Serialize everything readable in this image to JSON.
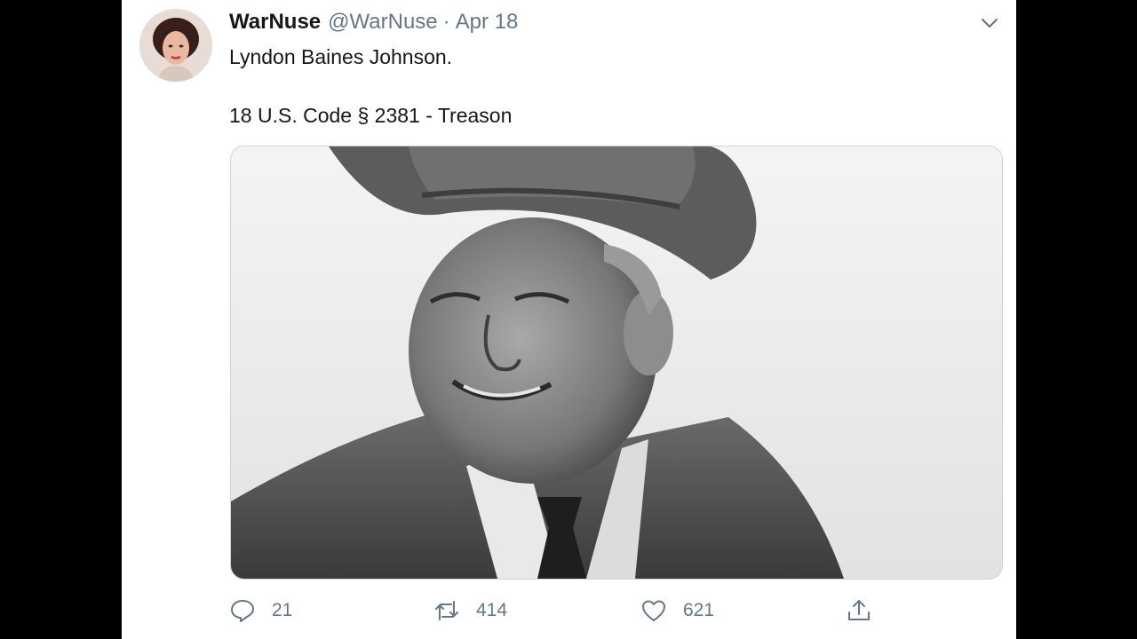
{
  "tweet": {
    "display_name": "WarNuse",
    "handle": "@WarNuse",
    "separator": "·",
    "date": "Apr 18",
    "text_line1": "Lyndon Baines Johnson.",
    "text_line2": "18 U.S. Code § 2381 - Treason"
  },
  "actions": {
    "reply_count": "21",
    "retweet_count": "414",
    "like_count": "621"
  },
  "icons": {
    "avatar": "profile-avatar",
    "menu": "chevron-down-icon",
    "reply": "reply-icon",
    "retweet": "retweet-icon",
    "like": "heart-icon",
    "share": "share-icon"
  },
  "colors": {
    "text": "#14171a",
    "secondary": "#657786",
    "background": "#ffffff",
    "frame": "#000000"
  }
}
